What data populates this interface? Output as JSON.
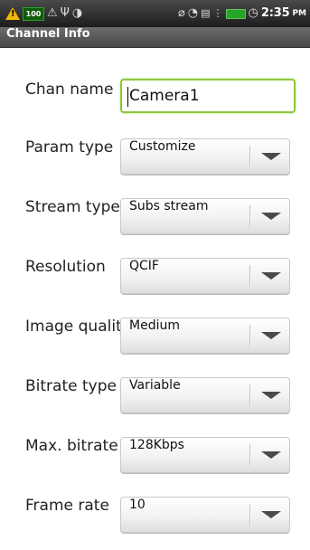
{
  "status_bar": {
    "time": "2:35",
    "ampm": "PM",
    "battery_badge": "100",
    "icons": [
      "warning-icon",
      "battery-badge-icon",
      "network-upload-icon",
      "usb-icon",
      "alarm-sync-icon",
      "vibrate-icon",
      "wifi-icon",
      "gps-icon",
      "signal-icon",
      "battery-icon",
      "alarm-clock-icon"
    ]
  },
  "title_bar": {
    "title": "Channel Info"
  },
  "form": {
    "chan_name": {
      "label": "Chan name",
      "value": "Camera1"
    },
    "rows": [
      {
        "label": "Param type",
        "value": "Customize"
      },
      {
        "label": "Stream type",
        "value": "Subs stream"
      },
      {
        "label": "Resolution",
        "value": "QCIF"
      },
      {
        "label": "Image quality",
        "value": "Medium"
      },
      {
        "label": "Bitrate type",
        "value": "Variable"
      },
      {
        "label": "Max. bitrate",
        "value": "128Kbps"
      },
      {
        "label": "Frame rate",
        "value": "10"
      }
    ]
  },
  "colors": {
    "status_bg": "#1c1c1c",
    "titlebar_bg": "#5a5a5a",
    "focus": "#8ec63f"
  }
}
